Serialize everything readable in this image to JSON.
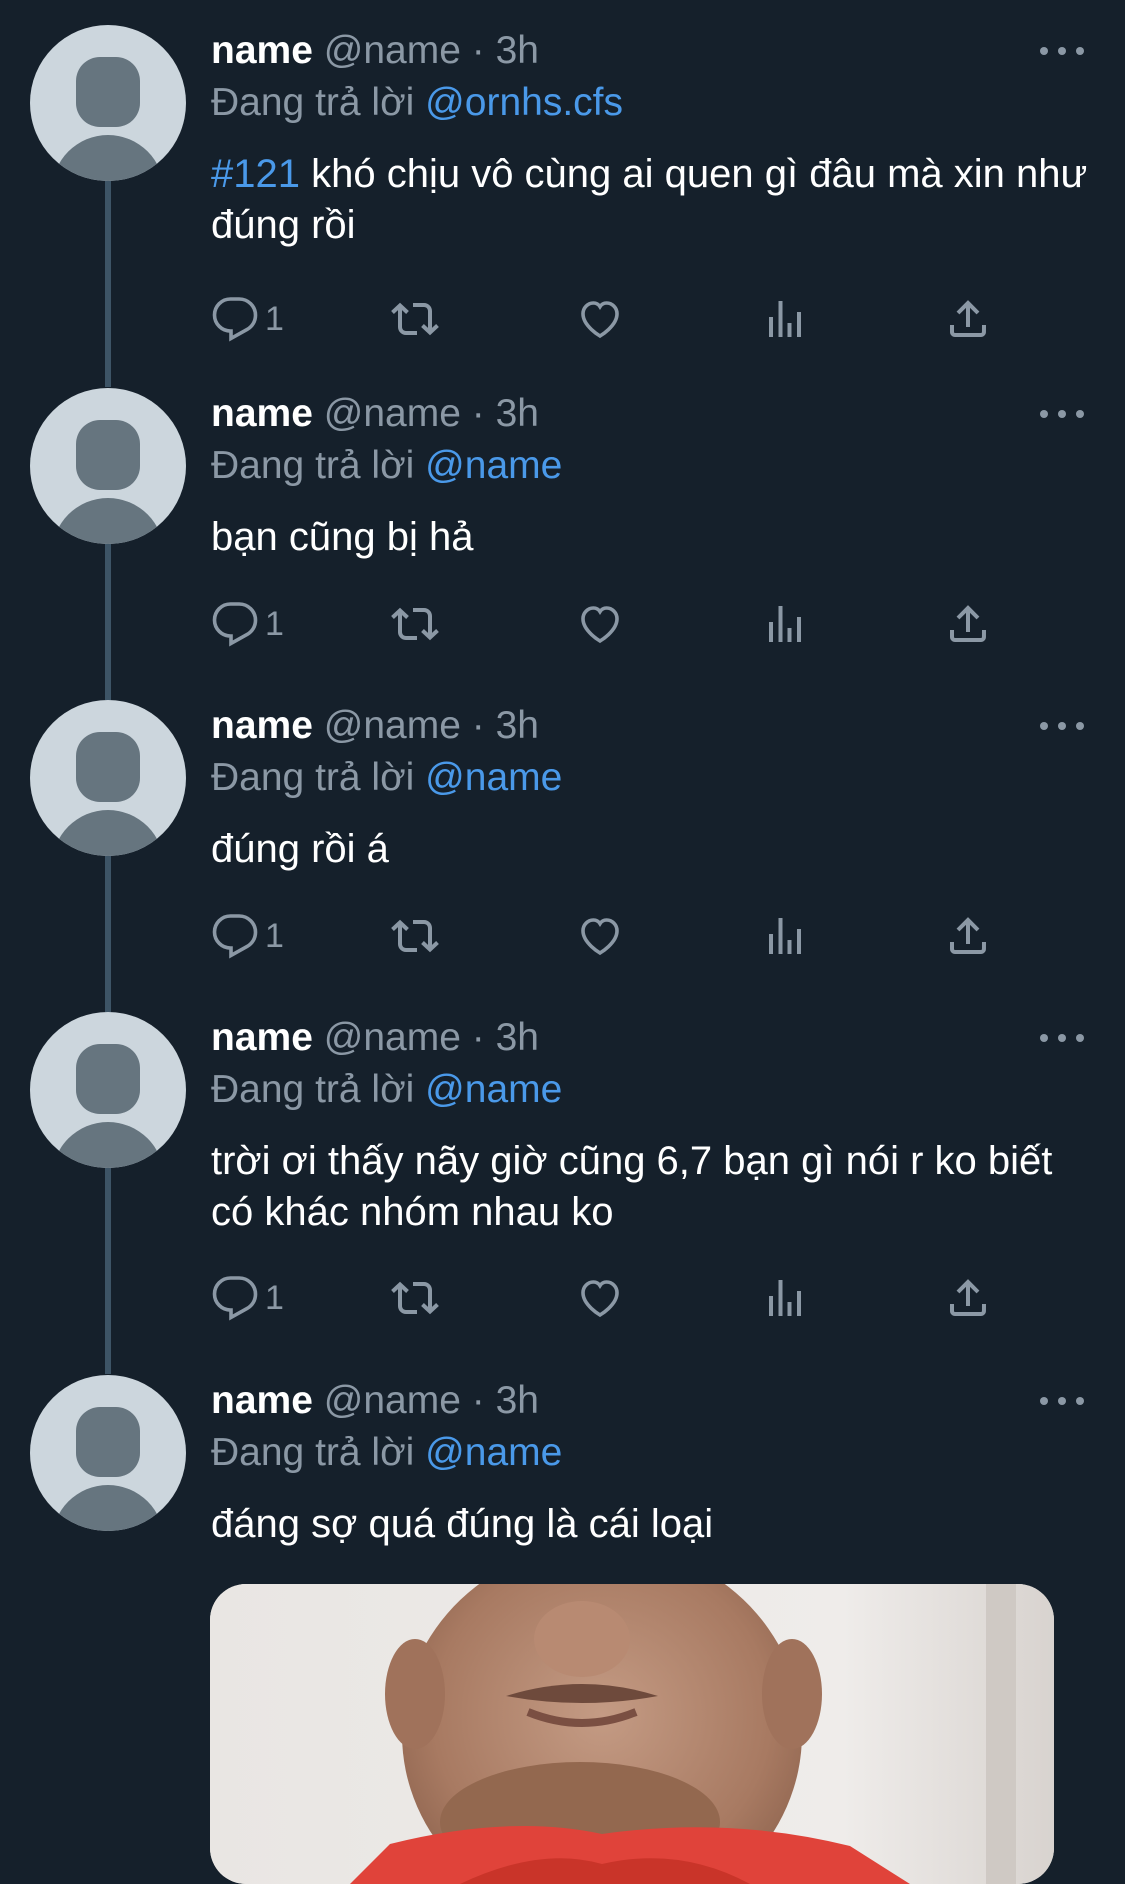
{
  "colors": {
    "background": "#15202b",
    "text": "#ffffff",
    "muted": "#8b98a5",
    "link": "#4a99e9",
    "thread_line": "#3d5466"
  },
  "tweets": [
    {
      "name": "name",
      "handle": "@name",
      "separator": "·",
      "time": "3h",
      "reply_prefix": "Đang trả lời",
      "reply_to": "@ornhs.cfs",
      "hashtag": "#121",
      "text": " khó chịu vô cùng ai quen gì đâu mà xin như đúng rồi",
      "reply_count": "1"
    },
    {
      "name": "name",
      "handle": "@name",
      "separator": "·",
      "time": "3h",
      "reply_prefix": "Đang trả lời",
      "reply_to": "@name",
      "text": "bạn cũng bị hả",
      "reply_count": "1"
    },
    {
      "name": "name",
      "handle": "@name",
      "separator": "·",
      "time": "3h",
      "reply_prefix": "Đang trả lời",
      "reply_to": "@name",
      "text": "đúng rồi á",
      "reply_count": "1"
    },
    {
      "name": "name",
      "handle": "@name",
      "separator": "·",
      "time": "3h",
      "reply_prefix": "Đang trả lời",
      "reply_to": "@name",
      "text": "trời ơi thấy nãy giờ cũng 6,7 bạn gì nói r ko biết có khác nhóm nhau ko",
      "reply_count": "1"
    },
    {
      "name": "name",
      "handle": "@name",
      "separator": "·",
      "time": "3h",
      "reply_prefix": "Đang trả lời",
      "reply_to": "@name",
      "text": "đáng sợ quá đúng là cái loại"
    }
  ],
  "icons": {
    "reply": "reply-icon",
    "retweet": "retweet-icon",
    "like": "heart-icon",
    "views": "analytics-icon",
    "share": "share-icon",
    "more": "more-icon"
  }
}
